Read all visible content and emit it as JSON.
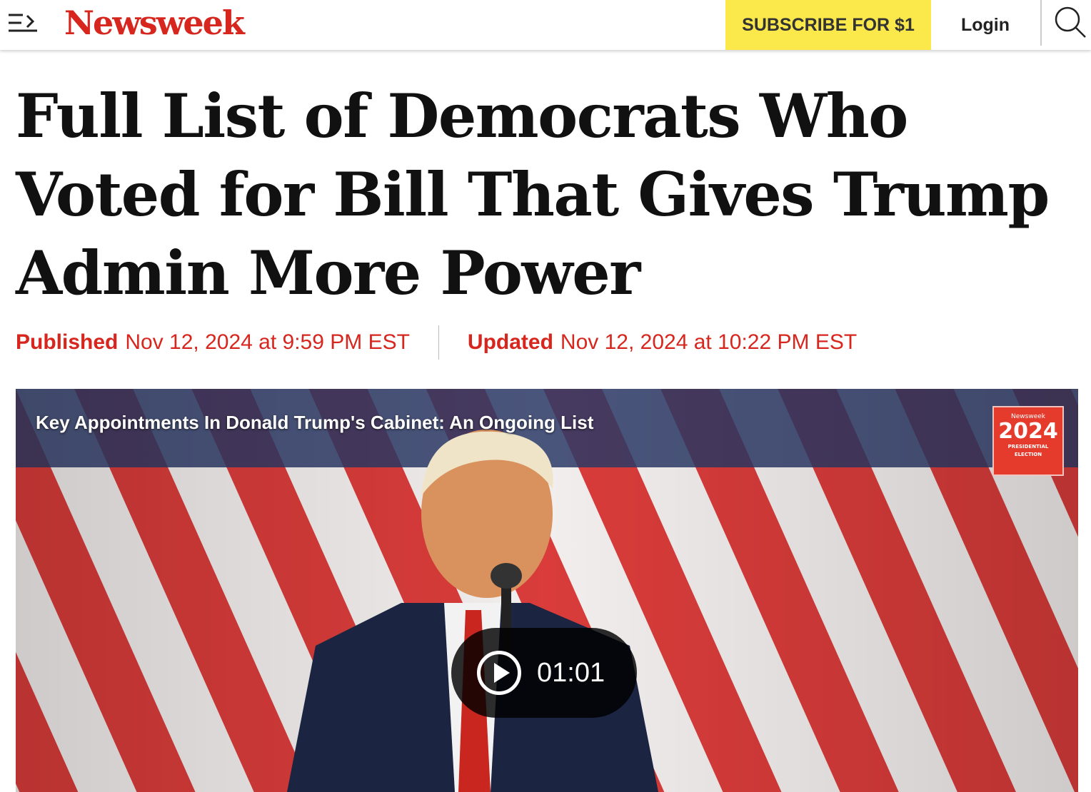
{
  "header": {
    "logo_text": "Newsweek",
    "subscribe_label": "SUBSCRIBE FOR $1",
    "login_label": "Login",
    "menu_icon": "menu-arrow-icon",
    "search_icon": "search-icon"
  },
  "article": {
    "headline": "Full List of Democrats Who Voted for Bill That Gives Trump Admin More Power",
    "published_label": "Published",
    "published_date": "Nov 12, 2024 at 9:59 PM EST",
    "updated_label": "Updated",
    "updated_date": "Nov 12, 2024 at 10:22 PM EST"
  },
  "video": {
    "title": "Key Appointments In Donald Trump's Cabinet: An Ongoing List",
    "duration": "01:01",
    "badge": {
      "brand": "Newsweek",
      "year": "2024",
      "line1": "PRESIDENTIAL",
      "line2": "ELECTION"
    }
  },
  "colors": {
    "brand_red": "#d7261e",
    "subscribe_yellow": "#fbe84b"
  }
}
